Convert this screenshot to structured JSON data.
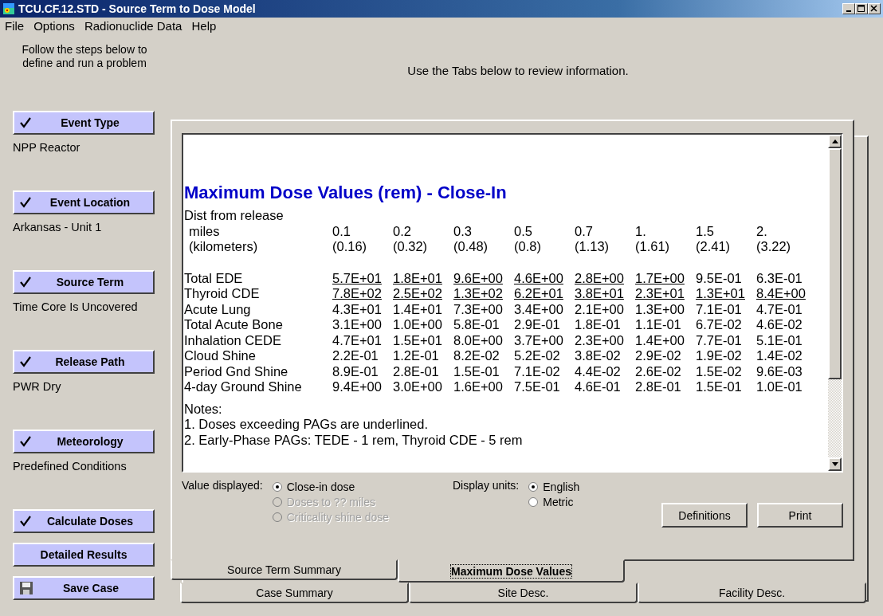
{
  "window": {
    "title": "TCU.CF.12.STD - Source Term to Dose Model"
  },
  "menu": [
    {
      "label": "File"
    },
    {
      "label": "Options"
    },
    {
      "label": "Radionuclide Data"
    },
    {
      "label": "Help"
    }
  ],
  "steps_intro": "Follow the steps below to define and run a problem",
  "steps": [
    {
      "kind": "step",
      "label": "Event Type",
      "checked": true,
      "status": "NPP Reactor"
    },
    {
      "kind": "step",
      "label": "Event Location",
      "checked": true,
      "status": "Arkansas - Unit 1"
    },
    {
      "kind": "step",
      "label": "Source Term",
      "checked": true,
      "status": "Time Core Is Uncovered"
    },
    {
      "kind": "step",
      "label": "Release Path",
      "checked": true,
      "status": "PWR Dry"
    },
    {
      "kind": "step",
      "label": "Meteorology",
      "checked": true,
      "status": "Predefined Conditions"
    },
    {
      "kind": "step",
      "label": "Calculate Doses",
      "checked": true
    },
    {
      "kind": "step",
      "label": "Detailed Results",
      "checked": false
    },
    {
      "kind": "save",
      "label": "Save Case"
    }
  ],
  "instructions": "Use the Tabs below to review information.",
  "report": {
    "title": "Maximum Dose Values (rem) - Close-In",
    "distance_label": "Dist from release",
    "miles_label": "miles",
    "miles": [
      "0.1",
      "0.2",
      "0.3",
      "0.5",
      "0.7",
      "1.",
      "1.5",
      "2."
    ],
    "km_label": "(kilometers)",
    "km": [
      "(0.16)",
      "(0.32)",
      "(0.48)",
      "(0.8)",
      "(1.13)",
      "(1.61)",
      "(2.41)",
      "(3.22)"
    ],
    "rows": [
      {
        "label": "Total EDE",
        "cells": [
          {
            "value": "5.7E+01",
            "underlined": true
          },
          {
            "value": "1.8E+01",
            "underlined": true
          },
          {
            "value": "9.6E+00",
            "underlined": true
          },
          {
            "value": "4.6E+00",
            "underlined": true
          },
          {
            "value": "2.8E+00",
            "underlined": true
          },
          {
            "value": "1.7E+00",
            "underlined": true
          },
          {
            "value": "9.5E-01",
            "underlined": false
          },
          {
            "value": "6.3E-01",
            "underlined": false
          }
        ]
      },
      {
        "label": "Thyroid CDE",
        "cells": [
          {
            "value": "7.8E+02",
            "underlined": true
          },
          {
            "value": "2.5E+02",
            "underlined": true
          },
          {
            "value": "1.3E+02",
            "underlined": true
          },
          {
            "value": "6.2E+01",
            "underlined": true
          },
          {
            "value": "3.8E+01",
            "underlined": true
          },
          {
            "value": "2.3E+01",
            "underlined": true
          },
          {
            "value": "1.3E+01",
            "underlined": true
          },
          {
            "value": "8.4E+00",
            "underlined": true
          }
        ]
      },
      {
        "label": "Acute Lung",
        "cells": [
          {
            "value": "4.3E+01",
            "underlined": false
          },
          {
            "value": "1.4E+01",
            "underlined": false
          },
          {
            "value": "7.3E+00",
            "underlined": false
          },
          {
            "value": "3.4E+00",
            "underlined": false
          },
          {
            "value": "2.1E+00",
            "underlined": false
          },
          {
            "value": "1.3E+00",
            "underlined": false
          },
          {
            "value": "7.1E-01",
            "underlined": false
          },
          {
            "value": "4.7E-01",
            "underlined": false
          }
        ]
      },
      {
        "label": "Total Acute Bone",
        "cells": [
          {
            "value": "3.1E+00",
            "underlined": false
          },
          {
            "value": "1.0E+00",
            "underlined": false
          },
          {
            "value": "5.8E-01",
            "underlined": false
          },
          {
            "value": "2.9E-01",
            "underlined": false
          },
          {
            "value": "1.8E-01",
            "underlined": false
          },
          {
            "value": "1.1E-01",
            "underlined": false
          },
          {
            "value": "6.7E-02",
            "underlined": false
          },
          {
            "value": "4.6E-02",
            "underlined": false
          }
        ]
      },
      {
        "label": "Inhalation CEDE",
        "cells": [
          {
            "value": "4.7E+01",
            "underlined": false
          },
          {
            "value": "1.5E+01",
            "underlined": false
          },
          {
            "value": "8.0E+00",
            "underlined": false
          },
          {
            "value": "3.7E+00",
            "underlined": false
          },
          {
            "value": "2.3E+00",
            "underlined": false
          },
          {
            "value": "1.4E+00",
            "underlined": false
          },
          {
            "value": "7.7E-01",
            "underlined": false
          },
          {
            "value": "5.1E-01",
            "underlined": false
          }
        ]
      },
      {
        "label": "Cloud Shine",
        "cells": [
          {
            "value": "2.2E-01",
            "underlined": false
          },
          {
            "value": "1.2E-01",
            "underlined": false
          },
          {
            "value": "8.2E-02",
            "underlined": false
          },
          {
            "value": "5.2E-02",
            "underlined": false
          },
          {
            "value": "3.8E-02",
            "underlined": false
          },
          {
            "value": "2.9E-02",
            "underlined": false
          },
          {
            "value": "1.9E-02",
            "underlined": false
          },
          {
            "value": "1.4E-02",
            "underlined": false
          }
        ]
      },
      {
        "label": "Period Gnd Shine",
        "cells": [
          {
            "value": "8.9E-01",
            "underlined": false
          },
          {
            "value": "2.8E-01",
            "underlined": false
          },
          {
            "value": "1.5E-01",
            "underlined": false
          },
          {
            "value": "7.1E-02",
            "underlined": false
          },
          {
            "value": "4.4E-02",
            "underlined": false
          },
          {
            "value": "2.6E-02",
            "underlined": false
          },
          {
            "value": "1.5E-02",
            "underlined": false
          },
          {
            "value": "9.6E-03",
            "underlined": false
          }
        ]
      },
      {
        "label": "4-day Ground Shine",
        "cells": [
          {
            "value": "9.4E+00",
            "underlined": false
          },
          {
            "value": "3.0E+00",
            "underlined": false
          },
          {
            "value": "1.6E+00",
            "underlined": false
          },
          {
            "value": "7.5E-01",
            "underlined": false
          },
          {
            "value": "4.6E-01",
            "underlined": false
          },
          {
            "value": "2.8E-01",
            "underlined": false
          },
          {
            "value": "1.5E-01",
            "underlined": false
          },
          {
            "value": "1.0E-01",
            "underlined": false
          }
        ]
      }
    ],
    "notes_title": "Notes:",
    "notes": [
      "1. Doses exceeding PAGs are underlined.",
      "2. Early-Phase PAGs: TEDE - 1 rem, Thyroid CDE - 5 rem"
    ]
  },
  "value_displayed": {
    "label": "Value displayed:",
    "options": [
      {
        "label": "Close-in dose",
        "selected": true,
        "disabled": false
      },
      {
        "label": "Doses to ?? miles",
        "selected": false,
        "disabled": true
      },
      {
        "label": "Criticality shine dose",
        "selected": false,
        "disabled": true
      }
    ]
  },
  "display_units": {
    "label": "Display units:",
    "options": [
      {
        "label": "English",
        "selected": true,
        "disabled": false
      },
      {
        "label": "Metric",
        "selected": false,
        "disabled": false
      }
    ]
  },
  "buttons": [
    "Definitions",
    "Print"
  ],
  "tab_rows": [
    [
      {
        "label": "Source Term Summary",
        "selected": false
      },
      {
        "label": "Maximum Dose Values",
        "selected": true
      }
    ],
    [
      {
        "label": "Case Summary",
        "selected": false
      },
      {
        "label": "Site Desc.",
        "selected": false
      },
      {
        "label": "Facility Desc.",
        "selected": false
      }
    ]
  ]
}
